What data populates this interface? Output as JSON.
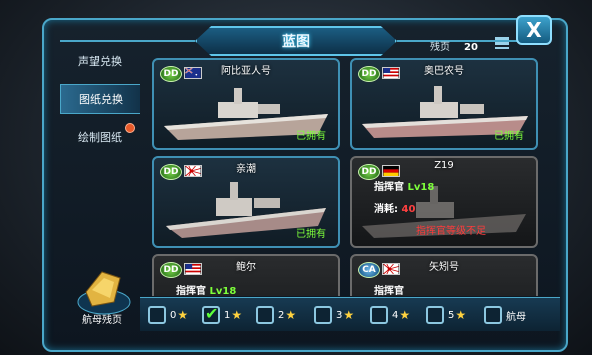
{
  "header": {
    "title": "蓝图",
    "remain_label": "残页",
    "remain_count": "20",
    "close_label": "X"
  },
  "sidebar": {
    "items": [
      {
        "label": "声望兑换"
      },
      {
        "label": "图纸兑换"
      },
      {
        "label": "绘制图纸"
      }
    ],
    "carrier_label": "航母残页"
  },
  "cards": [
    {
      "name": "阿比亚人号",
      "class": "DD",
      "status": "已拥有",
      "locked": false
    },
    {
      "name": "奥巴农号",
      "class": "DD",
      "status": "已拥有",
      "locked": false
    },
    {
      "name": "亲潮",
      "class": "DD",
      "status": "已拥有",
      "locked": false
    },
    {
      "name": "Z19",
      "class": "DD",
      "status": "",
      "locked": true,
      "commander_label": "指挥官",
      "commander_level": "Lv18",
      "cost_label": "消耗:",
      "cost_value": "40",
      "warning": "指挥官等级不足"
    },
    {
      "name": "鲍尔",
      "class": "DD",
      "status": "",
      "locked": true,
      "commander_label": "指挥官",
      "commander_level": "Lv18"
    },
    {
      "name": "矢矧号",
      "class": "CA",
      "status": "",
      "locked": true,
      "commander_label": "指挥官"
    }
  ],
  "filters": [
    {
      "label": "0",
      "checked": false
    },
    {
      "label": "1",
      "checked": true
    },
    {
      "label": "2",
      "checked": false
    },
    {
      "label": "3",
      "checked": false
    },
    {
      "label": "4",
      "checked": false
    },
    {
      "label": "5",
      "checked": false
    },
    {
      "label": "航母",
      "checked": false
    }
  ],
  "colors": {
    "accent": "#4aa7c9",
    "owned": "#7dff3a",
    "level_ok": "#7dff3a",
    "cost": "#ff4040",
    "warning": "#ff3b3b"
  }
}
